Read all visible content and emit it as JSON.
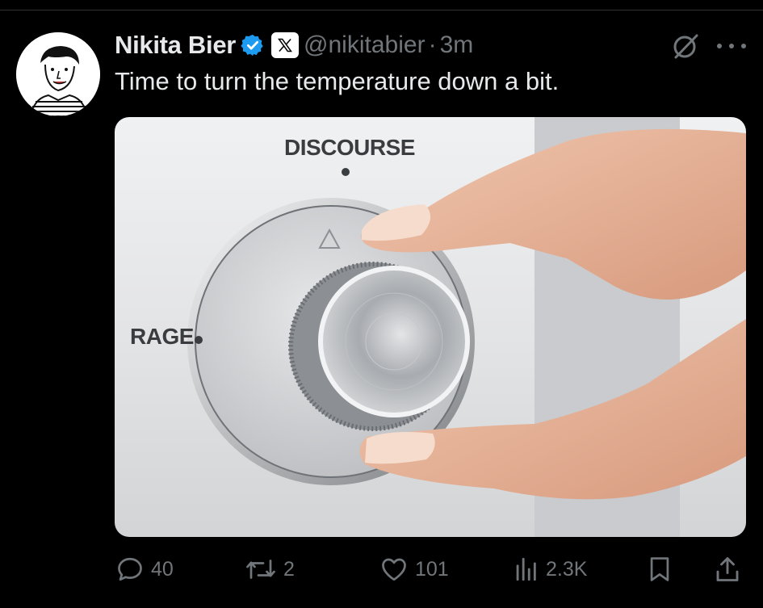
{
  "tweet": {
    "author_name": "Nikita Bier",
    "handle": "@nikitabier",
    "separator": "·",
    "time": "3m",
    "text": "Time to turn the temperature down a bit.",
    "media": {
      "label_top": "DISCOURSE",
      "label_left": "RAGE"
    }
  },
  "actions": {
    "replies": "40",
    "reposts": "2",
    "likes": "101",
    "views": "2.3K"
  },
  "colors": {
    "background": "#000000",
    "text": "#e7e9ea",
    "muted": "#71767b",
    "verified": "#1d9bf0"
  },
  "icons": [
    "verified-badge-icon",
    "x-logo-icon",
    "grok-icon",
    "more-icon",
    "reply-icon",
    "repost-icon",
    "like-icon",
    "views-icon",
    "bookmark-icon",
    "share-icon"
  ]
}
